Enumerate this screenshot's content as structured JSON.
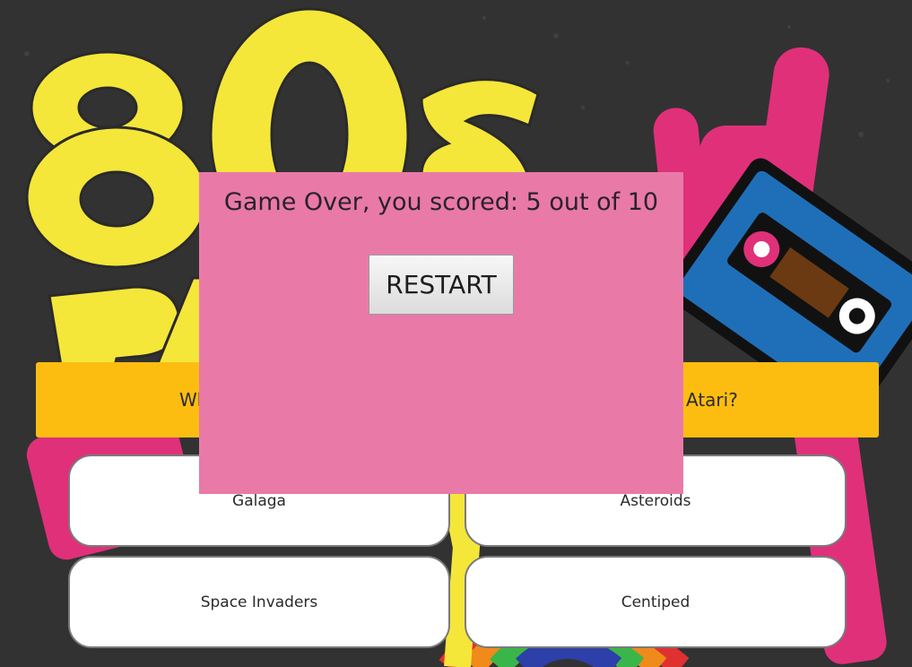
{
  "background": {
    "logo_text": "80s",
    "logo_text_2": "PA",
    "colors": {
      "page": "#323232",
      "logo_yellow": "#f5e63a",
      "hand_pink": "#e0307a",
      "cassette_blue": "#1f6fb8"
    }
  },
  "modal": {
    "title": "Game Over, you scored: 5 out of 10",
    "restart_label": "RESTART",
    "background_color": "#e97aa8"
  },
  "question": {
    "text_left": "Wh",
    "text_right": "Atari?",
    "background_color": "#fdbd10"
  },
  "answers": [
    {
      "label": "Galaga"
    },
    {
      "label": "Asteroids"
    },
    {
      "label": "Space Invaders"
    },
    {
      "label": "Centiped"
    }
  ]
}
